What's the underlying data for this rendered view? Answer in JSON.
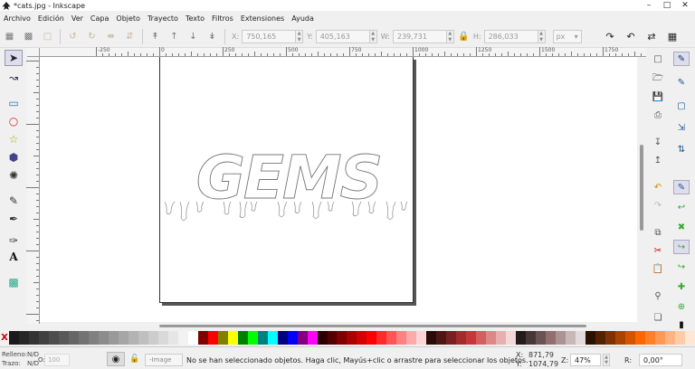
{
  "window": {
    "title": "*cats.jpg - Inkscape",
    "minimize": "–",
    "maximize": "□",
    "close": "✕"
  },
  "menu": [
    "Archivo",
    "Edición",
    "Ver",
    "Capa",
    "Objeto",
    "Trayecto",
    "Texto",
    "Filtros",
    "Extensiones",
    "Ayuda"
  ],
  "toolcontrols": {
    "x_label": "X:",
    "x_value": "750,165",
    "y_label": "Y:",
    "y_value": "405,163",
    "w_label": "W:",
    "w_value": "239,731",
    "h_label": "H:",
    "h_value": "286,033",
    "unit": "px"
  },
  "ruler": {
    "labels": [
      "-250",
      "0",
      "250",
      "500",
      "750",
      "1000",
      "1250",
      "1500",
      "1750"
    ]
  },
  "canvas": {
    "artwork_text": "GEMS"
  },
  "palette": {
    "none_symbol": "X",
    "colors": [
      "#1a1a1a",
      "#262626",
      "#333333",
      "#404040",
      "#4d4d4d",
      "#595959",
      "#666666",
      "#737373",
      "#808080",
      "#8c8c8c",
      "#999999",
      "#a6a6a6",
      "#b3b3b3",
      "#bfbfbf",
      "#cccccc",
      "#d9d9d9",
      "#e6e6e6",
      "#f2f2f2",
      "#ffffff",
      "#800000",
      "#ff0000",
      "#808000",
      "#ffff00",
      "#008000",
      "#00ff00",
      "#008080",
      "#00ffff",
      "#000080",
      "#0000ff",
      "#800080",
      "#ff00ff",
      "#2b0000",
      "#550000",
      "#800000",
      "#aa0000",
      "#d40000",
      "#ff0000",
      "#ff2a2a",
      "#ff5555",
      "#ff8080",
      "#ffaaaa",
      "#ffd5d5",
      "#280b0b",
      "#501616",
      "#782121",
      "#a02c2c",
      "#c83737",
      "#d35f5f",
      "#de8787",
      "#e9afaf",
      "#f4d7d7",
      "#241c1c",
      "#483737",
      "#6c5353",
      "#916f6f",
      "#ac9393",
      "#c8b7b7",
      "#e3dbdb",
      "#2b1100",
      "#552200",
      "#803300",
      "#aa4400",
      "#d45500",
      "#ff6600",
      "#ff7f2a",
      "#ff9955",
      "#ffb380",
      "#ffccaa",
      "#ffe6d5"
    ]
  },
  "status": {
    "fill_label": "Relleno:",
    "fill_value": "N/D",
    "stroke_label": "Trazo:",
    "stroke_value": "N/D",
    "opacity_label": "O:",
    "opacity_value": "100",
    "layer": "-Image",
    "message": "No se han seleccionado objetos. Haga clic, Mayús+clic o arrastre para seleccionar los objetos.",
    "x_label": "X:",
    "x_value": "871,79",
    "y_label": "Y:",
    "y_value": "1074,79",
    "zoom_label": "Z:",
    "zoom_value": "47%",
    "rotation_label": "R:",
    "rotation_value": "0,00°"
  }
}
